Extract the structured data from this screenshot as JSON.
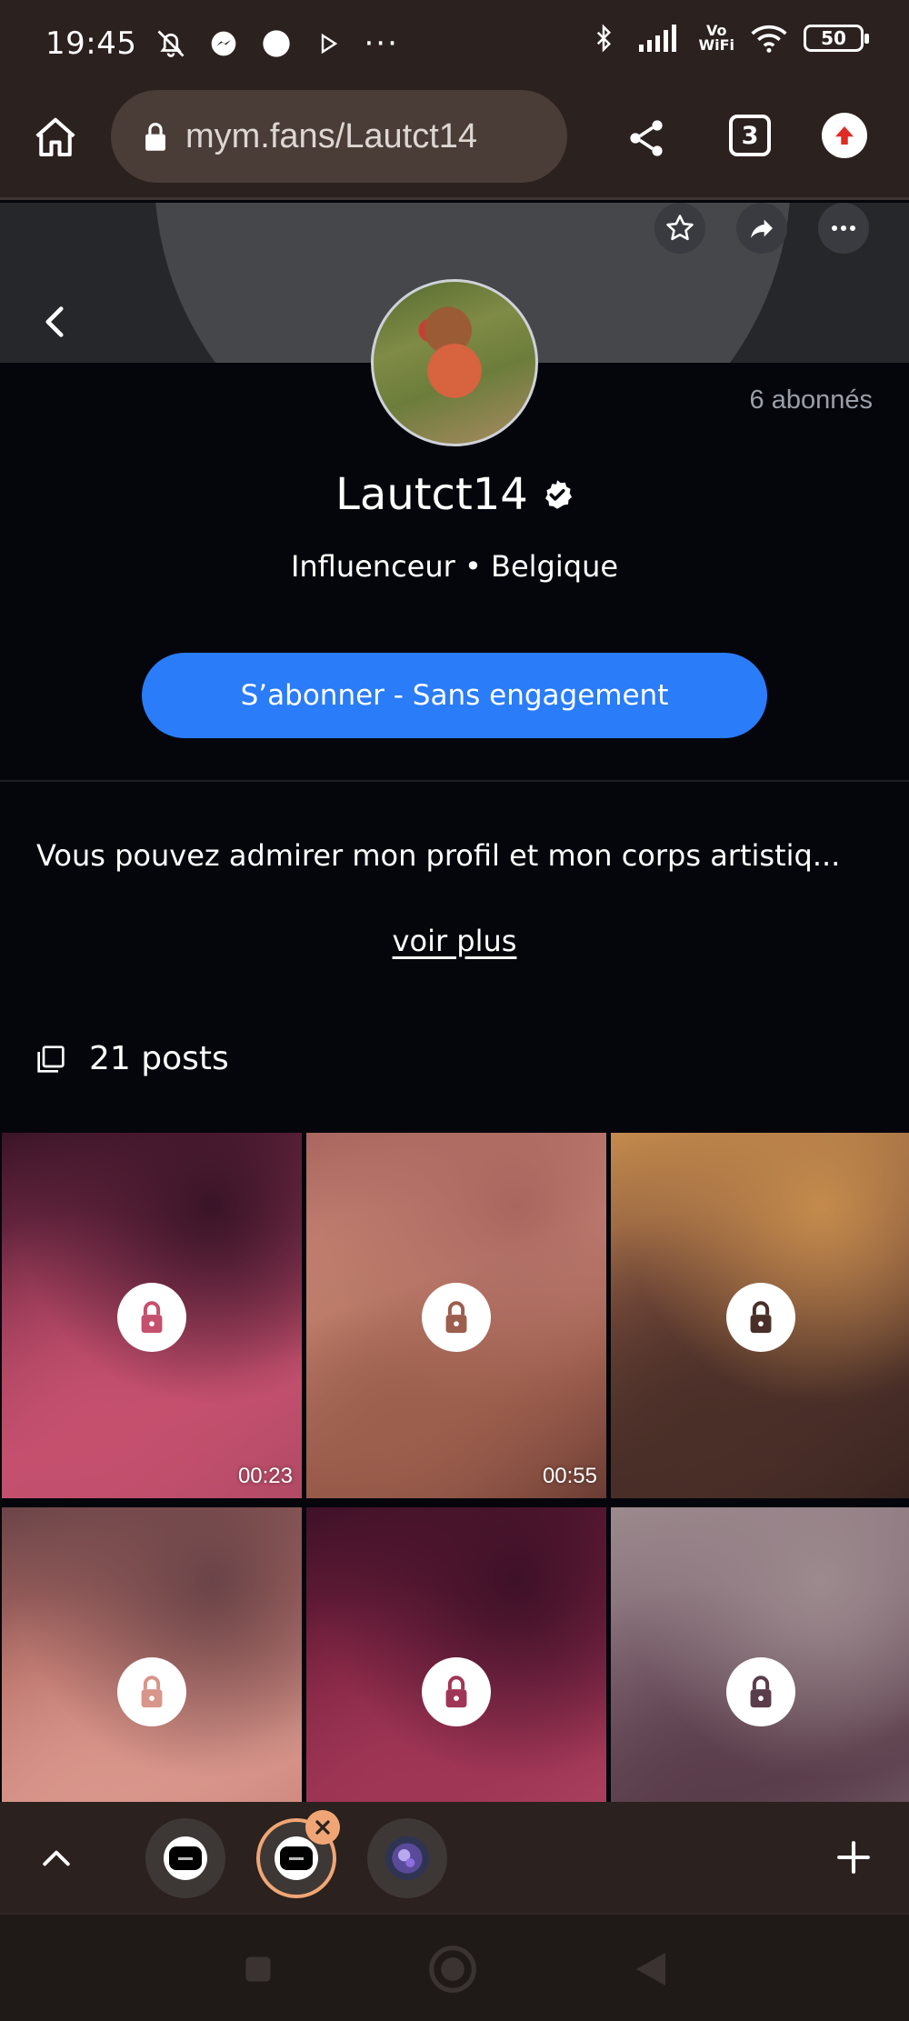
{
  "status_bar": {
    "time": "19:45",
    "more": "···",
    "vo": "Vo",
    "wifi_label": "WiFi",
    "battery": "50"
  },
  "browser": {
    "url": "mym.fans/Lautct14",
    "tab_count": "3"
  },
  "profile": {
    "subscribers": "6 abonnés",
    "username": "Lautct14",
    "subtitle": "Influenceur • Belgique",
    "subscribe_label": "S’abonner - Sans engagement",
    "bio": "Vous pouvez admirer mon profil et mon corps artistiq...",
    "see_more": "voir plus",
    "posts_count": "21 posts"
  },
  "posts": [
    {
      "duration": "00:23",
      "colors": [
        "#3a1428",
        "#8b3450",
        "#c4506e",
        "#b04a65"
      ]
    },
    {
      "duration": "00:55",
      "colors": [
        "#a8665f",
        "#d08f7b",
        "#9c5e4d",
        "#6a3c33"
      ]
    },
    {
      "duration": "",
      "colors": [
        "#c48b4c",
        "#7b4d3d",
        "#4a2f28",
        "#3a2420"
      ]
    },
    {
      "duration": "",
      "colors": [
        "#6a4448",
        "#b87068",
        "#d8958a",
        "#c98078"
      ]
    },
    {
      "duration": "",
      "colors": [
        "#3e1128",
        "#7c2240",
        "#a03656",
        "#b24a66"
      ]
    },
    {
      "duration": "",
      "colors": [
        "#9c8a8e",
        "#7e6470",
        "#5a3d4a",
        "#7a6670"
      ]
    }
  ],
  "colors": {
    "accent": "#2a7cf8",
    "background": "#05060c",
    "chrome": "#2b211e",
    "active_tab_ring": "#f0a674",
    "lock_icon": "#9b2b48"
  }
}
